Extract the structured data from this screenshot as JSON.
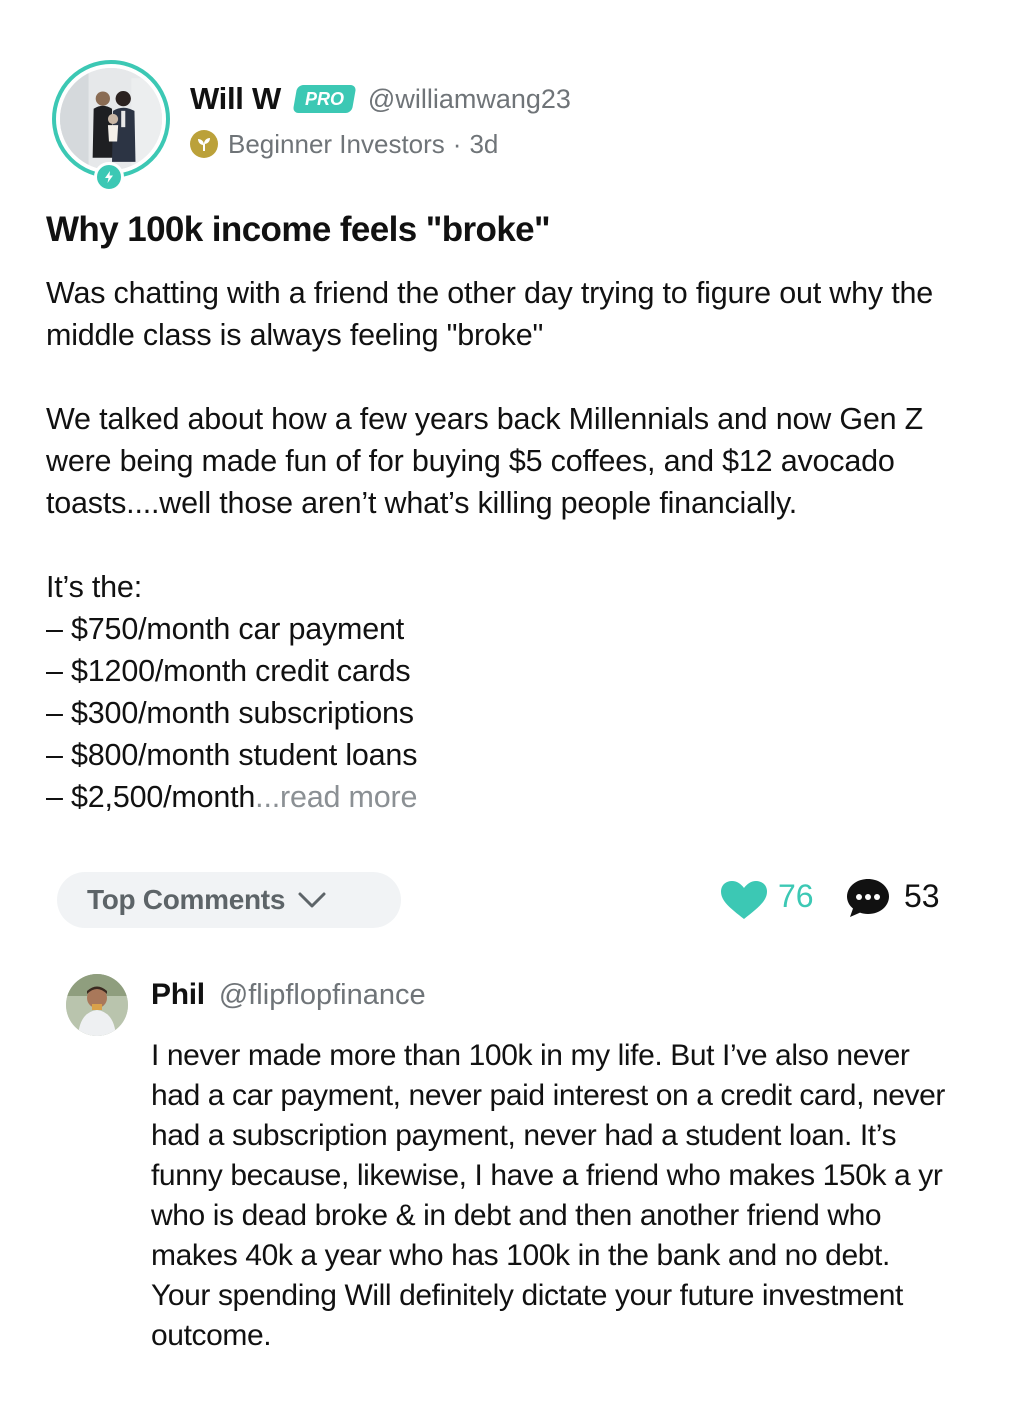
{
  "post": {
    "author": {
      "name": "Will W",
      "badge": "PRO",
      "handle": "@williamwang23",
      "avatar_icon": "user-photo-avatar",
      "status_icon": "lightning-bolt-icon"
    },
    "community": "Beginner Investors",
    "separator": "·",
    "age": "3d",
    "title": "Why 100k income feels \"broke\"",
    "body": {
      "para1": "Was chatting with a friend the other day trying to figure out why the middle class is always feeling \"broke\"",
      "para2": "We talked about how a few years back Millennials and now Gen Z were being made fun of for buying $5 coffees, and $12 avocado toasts....well those aren’t what’s killing people financially.",
      "list_intro": "It’s the:",
      "list_items": [
        "– $750/month car payment",
        "– $1200/month credit cards",
        "– $300/month subscriptions",
        "– $800/month student loans"
      ],
      "last_item": "– $2,500/month",
      "read_more": "...read more"
    }
  },
  "actions": {
    "top_comments_label": "Top Comments",
    "likes": "76",
    "comments": "53"
  },
  "comment": {
    "name": "Phil",
    "handle": "@flipflopfinance",
    "text": "I never made more than 100k in my life. But I’ve also never had a car payment, never paid interest on a credit card, never had a subscription payment, never had a student loan. It’s funny because, likewise, I have a friend who makes 150k a yr who is dead broke & in debt and then another friend who makes 40k a year who has 100k in the bank and no debt. Your spending Will definitely dictate your future investment outcome."
  },
  "colors": {
    "accent": "#3cc8b4",
    "muted_text": "#6f7478",
    "community_icon": "#bba13a",
    "pill_bg": "#f1f3f5"
  }
}
